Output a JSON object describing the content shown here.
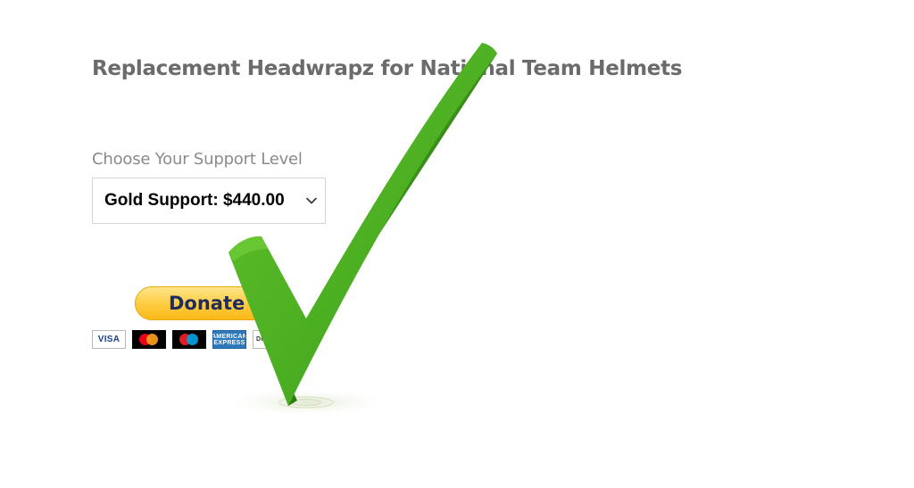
{
  "page": {
    "title": "Replacement Headwrapz for National Team Helmets"
  },
  "support": {
    "label": "Choose Your Support Level",
    "selected_value": "Gold Support: $440.00"
  },
  "donate": {
    "button_label": "Donate"
  },
  "payment_cards": [
    {
      "name": "visa-card",
      "label": "VISA"
    },
    {
      "name": "mastercard-card",
      "label": ""
    },
    {
      "name": "maestro-card",
      "label": ""
    },
    {
      "name": "amex-card",
      "label": "AMERICAN EXPRESS"
    },
    {
      "name": "discover-card",
      "label": "DISC"
    }
  ],
  "colors": {
    "title_text": "#6b6b6b",
    "label_text": "#8a8a8a",
    "donate_yellow": "#fecd44",
    "donate_text": "#1f2d5c",
    "checkmark_green": "#4caf22"
  },
  "overlay": {
    "icon": "checkmark-icon"
  }
}
